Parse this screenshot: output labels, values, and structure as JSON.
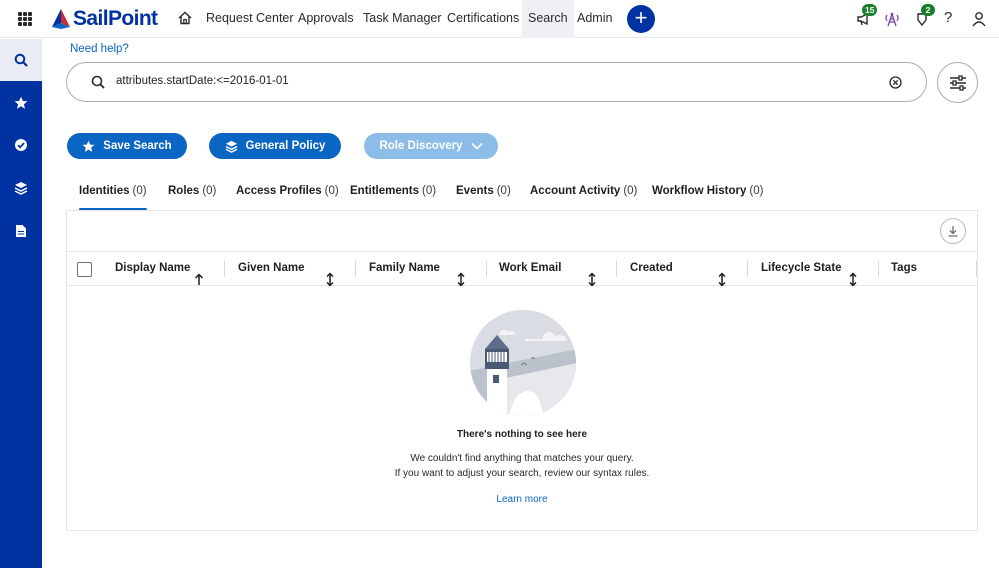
{
  "app": {
    "logo_text": "SailPoint",
    "brand_color": "#0033a1",
    "accent_color": "#0a66c2"
  },
  "topnav": {
    "items": [
      {
        "label": "Request Center"
      },
      {
        "label": "Approvals"
      },
      {
        "label": "Task Manager"
      },
      {
        "label": "Certifications"
      },
      {
        "label": "Search",
        "active": true
      },
      {
        "label": "Admin"
      }
    ],
    "notifications_count": "15",
    "tasks_count": "2",
    "help_label": "?"
  },
  "sidebar": {
    "items": [
      {
        "icon": "search-icon",
        "active": true
      },
      {
        "icon": "star-icon"
      },
      {
        "icon": "check-circle-icon"
      },
      {
        "icon": "layers-icon"
      },
      {
        "icon": "document-icon"
      }
    ]
  },
  "main": {
    "need_help": "Need help?",
    "search": {
      "query": "attributes.startDate:<=2016-01-01"
    },
    "actions": {
      "save_search": "Save Search",
      "general_policy": "General Policy",
      "role_discovery": "Role Discovery"
    },
    "tabs": [
      {
        "label": "Identities",
        "count": "(0)",
        "active": true
      },
      {
        "label": "Roles",
        "count": "(0)"
      },
      {
        "label": "Access Profiles",
        "count": "(0)"
      },
      {
        "label": "Entitlements",
        "count": "(0)"
      },
      {
        "label": "Events",
        "count": "(0)"
      },
      {
        "label": "Account Activity",
        "count": "(0)"
      },
      {
        "label": "Workflow History",
        "count": "(0)"
      }
    ],
    "table": {
      "columns": [
        "Display Name",
        "Given Name",
        "Family Name",
        "Work Email",
        "Created",
        "Lifecycle State",
        "Tags"
      ]
    },
    "empty_state": {
      "title": "There's nothing to see here",
      "line1": "We couldn't find anything that matches your query.",
      "line2": "If you want to adjust your search, review our syntax rules.",
      "link": "Learn more"
    }
  }
}
